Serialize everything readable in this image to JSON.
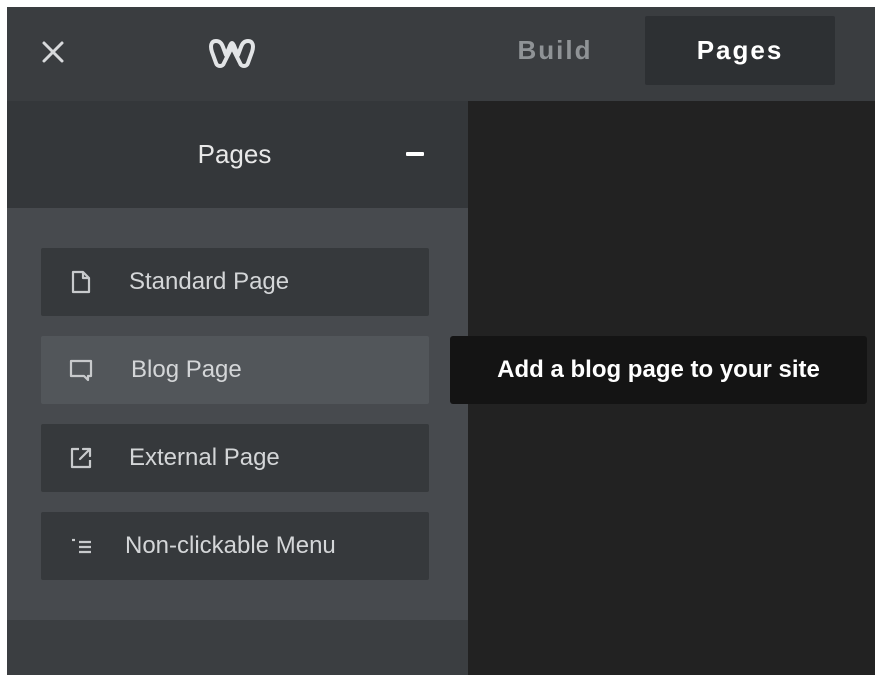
{
  "topbar": {
    "tabs": [
      {
        "label": "Build",
        "active": false
      },
      {
        "label": "Pages",
        "active": true
      }
    ]
  },
  "panel": {
    "title": "Pages",
    "items": [
      {
        "label": "Standard Page",
        "icon": "document-icon"
      },
      {
        "label": "Blog Page",
        "icon": "chat-bubble-icon"
      },
      {
        "label": "External Page",
        "icon": "external-link-icon"
      },
      {
        "label": "Non-clickable Menu",
        "icon": "list-menu-icon"
      }
    ]
  },
  "tooltip": {
    "text": "Add a blog page to your site"
  },
  "colors": {
    "topbar": "#3a3d40",
    "active_tab": "#2d3033",
    "panel_header": "#34373a",
    "panel_body": "#474a4e",
    "item": "#36393c",
    "item_hover": "#52565a",
    "canvas": "#222222",
    "tooltip": "#141414"
  }
}
